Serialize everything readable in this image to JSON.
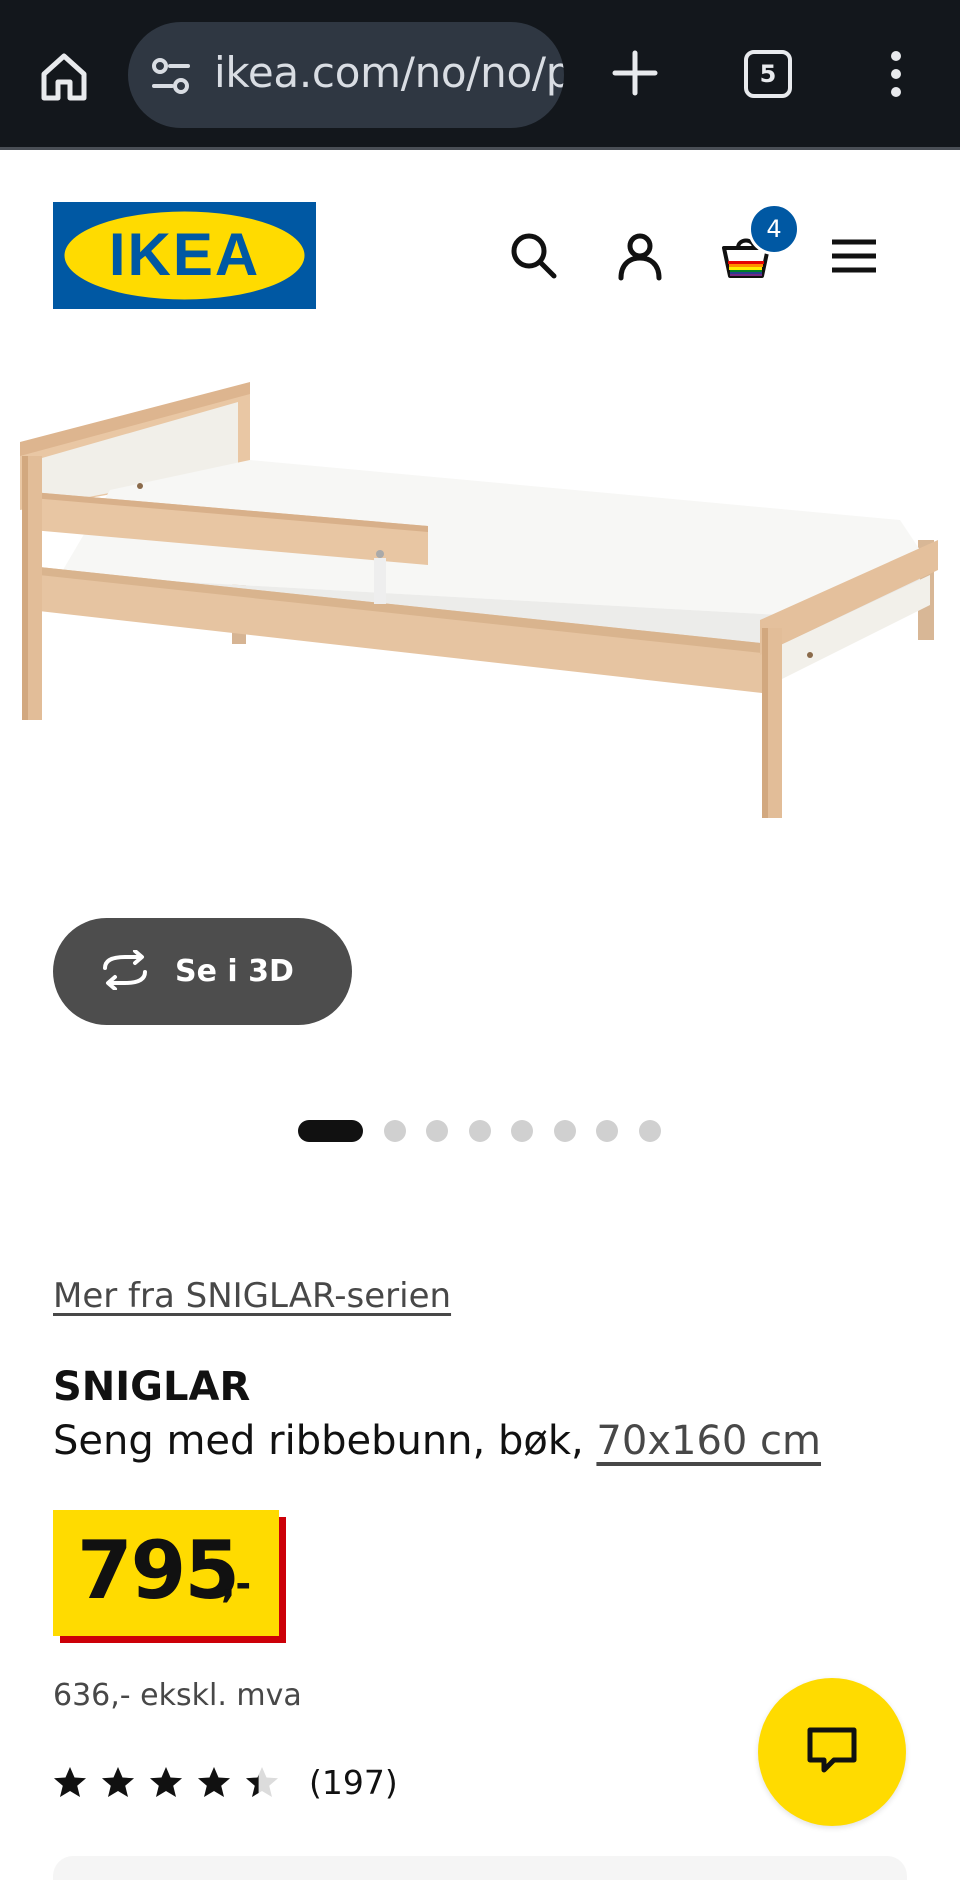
{
  "browser": {
    "url": "ikea.com/no/no/p",
    "tab_count": "5"
  },
  "header": {
    "logo_text": "IKEA",
    "cart_count": "4"
  },
  "product": {
    "view_3d_label": "Se i 3D",
    "image_count": 8,
    "active_image": 1,
    "series_link": "Mer fra SNIGLAR-serien",
    "name": "SNIGLAR",
    "description": "Seng med ribbebunn, bøk, ",
    "size_link": "70x160 cm",
    "price": "795",
    "price_suffix": ",-",
    "price_ex_vat": "636,- ekskl. mva",
    "rating": 4.4,
    "rating_max": 5,
    "review_count": "(197)"
  },
  "colors": {
    "brand_blue": "#0058a3",
    "brand_yellow": "#ffdb00",
    "price_shadow_red": "#cc0008"
  }
}
